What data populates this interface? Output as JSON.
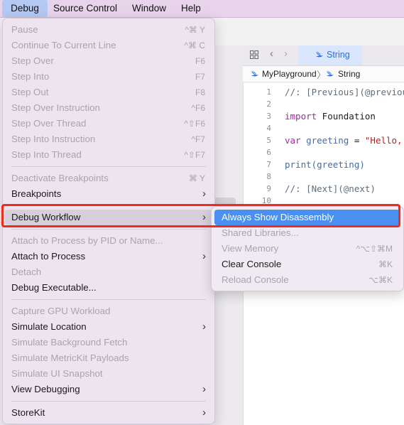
{
  "menubar": {
    "items": [
      "Debug",
      "Source Control",
      "Window",
      "Help"
    ]
  },
  "editor": {
    "tab_label": "String",
    "breadcrumb": [
      "MyPlayground",
      "String"
    ],
    "line_numbers": [
      "1",
      "2",
      "3",
      "4",
      "5",
      "6",
      "7",
      "8",
      "9",
      "10"
    ],
    "code": {
      "l1": "//: [Previous](@previou",
      "l3_kw": "import",
      "l3_rest": " Foundation",
      "l5_kw": "var",
      "l5_name": " greeting",
      "l5_eq": " = ",
      "l5_str": "\"Hello,",
      "l7": "print(greeting)",
      "l9": "//: [Next](@next)"
    }
  },
  "debug_menu": {
    "items": [
      {
        "label": "Pause",
        "shortcut": "^⌘ Y",
        "enabled": false
      },
      {
        "label": "Continue To Current Line",
        "shortcut": "^⌘ C",
        "enabled": false
      },
      {
        "label": "Step Over",
        "shortcut": "F6",
        "enabled": false
      },
      {
        "label": "Step Into",
        "shortcut": "F7",
        "enabled": false
      },
      {
        "label": "Step Out",
        "shortcut": "F8",
        "enabled": false
      },
      {
        "label": "Step Over Instruction",
        "shortcut": "^F6",
        "enabled": false
      },
      {
        "label": "Step Over Thread",
        "shortcut": "^⇧F6",
        "enabled": false
      },
      {
        "label": "Step Into Instruction",
        "shortcut": "^F7",
        "enabled": false
      },
      {
        "label": "Step Into Thread",
        "shortcut": "^⇧F7",
        "enabled": false
      },
      {
        "label": "Deactivate Breakpoints",
        "shortcut": "⌘ Y",
        "enabled": false
      },
      {
        "label": "Breakpoints",
        "enabled": true
      },
      {
        "label": "Debug Workflow",
        "enabled": true
      },
      {
        "label": "Attach to Process by PID or Name...",
        "enabled": false
      },
      {
        "label": "Attach to Process",
        "enabled": true
      },
      {
        "label": "Detach",
        "enabled": false
      },
      {
        "label": "Debug Executable...",
        "enabled": true
      },
      {
        "label": "Capture GPU Workload",
        "enabled": false
      },
      {
        "label": "Simulate Location",
        "enabled": true
      },
      {
        "label": "Simulate Background Fetch",
        "enabled": false
      },
      {
        "label": "Simulate MetricKit Payloads",
        "enabled": false
      },
      {
        "label": "Simulate UI Snapshot",
        "enabled": false
      },
      {
        "label": "View Debugging",
        "enabled": true
      },
      {
        "label": "StoreKit",
        "enabled": true
      }
    ]
  },
  "debug_workflow_submenu": {
    "items": [
      {
        "label": "Always Show Disassembly",
        "shortcut": "",
        "enabled": true,
        "highlighted": true
      },
      {
        "label": "Shared Libraries...",
        "shortcut": "",
        "enabled": false
      },
      {
        "label": "View Memory",
        "shortcut": "^⌥⇧⌘M",
        "enabled": false
      },
      {
        "label": "Clear Console",
        "shortcut": "⌘K",
        "enabled": true
      },
      {
        "label": "Reload Console",
        "shortcut": "⌥⌘K",
        "enabled": false
      }
    ]
  },
  "colors": {
    "highlight_box": "#ef2b1d",
    "selection": "#4a90f0",
    "menubar_active": "#b3c8f2"
  }
}
